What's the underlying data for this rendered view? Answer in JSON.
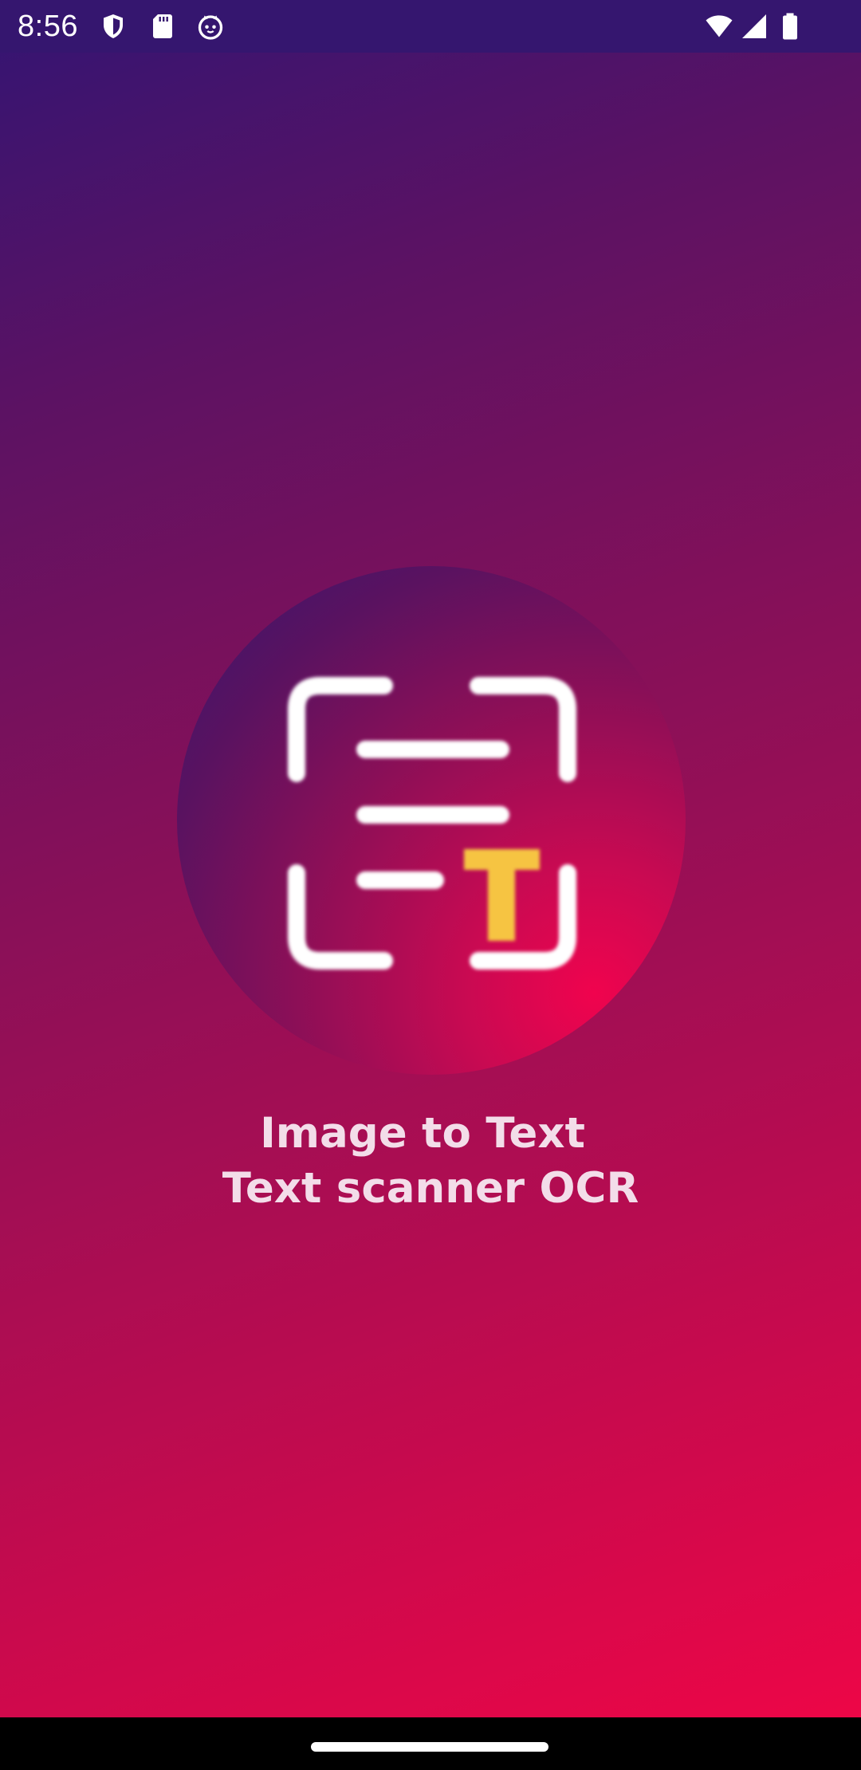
{
  "status_bar": {
    "time": "8:56",
    "left_icons": [
      "shield-icon",
      "sd-card-icon",
      "cat-face-icon"
    ],
    "right_icons": [
      "wifi-icon",
      "cellular-signal-icon",
      "battery-icon"
    ]
  },
  "splash": {
    "logo_icon": "text-scanner-logo-icon",
    "logo_letter": "T",
    "title_line_1": "Image to Text",
    "title_line_2": "Text scanner OCR"
  },
  "colors": {
    "background_top": "#331573",
    "background_bottom": "#f20546",
    "status_bar": "#35166f",
    "logo_accent": "#f6c443",
    "title_text": "#f3dde9"
  },
  "nav_bar": {
    "indicator": "home-indicator"
  }
}
